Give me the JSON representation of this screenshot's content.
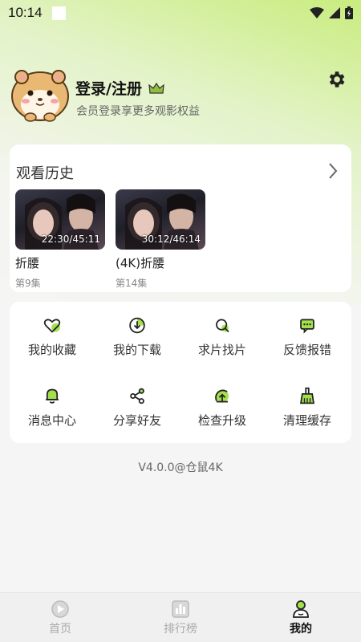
{
  "status_bar": {
    "time": "10:14"
  },
  "profile": {
    "login_title": "登录/注册",
    "subtitle": "会员登录享更多观影权益"
  },
  "history": {
    "title": "观看历史",
    "items": [
      {
        "title": "折腰",
        "episode": "第9集",
        "time": "22:30/45:11"
      },
      {
        "title": "(4K)折腰",
        "episode": "第14集",
        "time": "30:12/46:14"
      }
    ]
  },
  "menu": {
    "items": [
      {
        "label": "我的收藏",
        "icon": "heart-icon"
      },
      {
        "label": "我的下载",
        "icon": "download-icon"
      },
      {
        "label": "求片找片",
        "icon": "search-icon"
      },
      {
        "label": "反馈报错",
        "icon": "feedback-icon"
      },
      {
        "label": "消息中心",
        "icon": "bell-icon"
      },
      {
        "label": "分享好友",
        "icon": "share-icon"
      },
      {
        "label": "检查升级",
        "icon": "upgrade-icon"
      },
      {
        "label": "清理缓存",
        "icon": "broom-icon"
      }
    ]
  },
  "version": "V4.0.0@仓鼠4K",
  "tabs": [
    {
      "label": "首页",
      "active": false
    },
    {
      "label": "排行榜",
      "active": false
    },
    {
      "label": "我的",
      "active": true
    }
  ],
  "colors": {
    "accent": "#a3e04c",
    "background": "#f5f5f5"
  }
}
